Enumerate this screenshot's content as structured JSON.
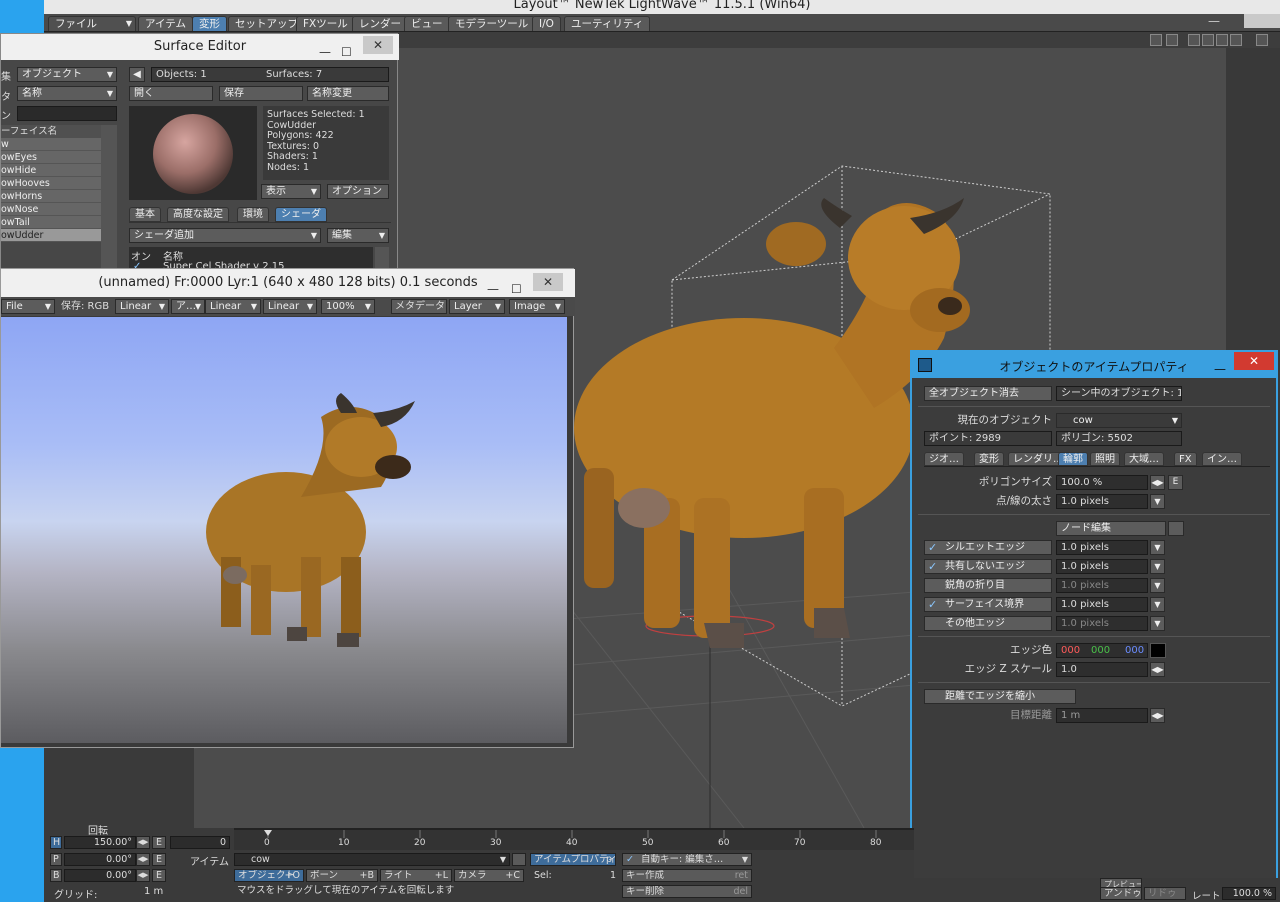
{
  "app": {
    "title": "Layout™ NewTek LightWave™ 11.5.1 (Win64)",
    "menu": {
      "file_label": "ファイル",
      "tabs": [
        "アイテム",
        "変形",
        "セットアップ",
        "FXツール",
        "レンダー",
        "ビュー",
        "モデラーツール",
        "I/O",
        "ユーティリティ"
      ],
      "active_tab": "変形"
    }
  },
  "surface_editor": {
    "title": "Surface Editor",
    "edit_label": "集",
    "edit_value": "オブジェクト",
    "filter_label": "タ",
    "filter_value": "名称",
    "pattern_label": "ン",
    "objects": "Objects: 1",
    "surfaces": "Surfaces: 7",
    "buttons": {
      "open": "開く",
      "save": "保存",
      "rename": "名称変更"
    },
    "list_header": "ーフェイス名",
    "surface_list": [
      "w",
      "owEyes",
      "owHide",
      "owHooves",
      "owHorns",
      "owNose",
      "owTail",
      "owUdder"
    ],
    "info": [
      "Surfaces Selected: 1",
      "CowUdder",
      "Polygons: 422",
      "Textures: 0",
      "Shaders: 1",
      "Nodes: 1"
    ],
    "display_label": "表示",
    "options_label": "オプション",
    "tabs": [
      "基本",
      "高度な設定",
      "環境",
      "シェーダ"
    ],
    "active_tab": "シェーダ",
    "add_shader": "シェーダ追加",
    "edit_btn": "編集",
    "shader_cols": [
      "オン",
      "名称"
    ],
    "shader_row": "Super Cel Shader v 2.15"
  },
  "render_window": {
    "title": "(unnamed) Fr:0000 Lyr:1  (640 x 480 128 bits) 0.1 seconds",
    "tools": [
      "File",
      "保存: RGB",
      "Linear",
      "ア…",
      "Linear",
      "Linear",
      "100%",
      "メタデータ",
      "Layer",
      "Image"
    ]
  },
  "properties": {
    "title": "オブジェクトのアイテムプロパティ",
    "clear_all": "全オブジェクト消去",
    "scene_objects": "シーン中のオブジェクト: 1",
    "current_object_label": "現在のオブジェクト",
    "current_object": "cow",
    "points": "ポイント: 2989",
    "polygons": "ポリゴン: 5502",
    "tabs": [
      "ジオ…",
      "変形",
      "レンダリ…",
      "輪郭",
      "照明",
      "大域…",
      "FX",
      "イン…"
    ],
    "active_tab": "輪郭",
    "polygon_size_label": "ポリゴンサイズ",
    "polygon_size": "100.0 %",
    "point_line_label": "点/線の太さ",
    "point_line": "1.0 pixels",
    "node_edit": "ノード編集",
    "edges": [
      {
        "label": "シルエットエッジ",
        "checked": true,
        "value": "1.0 pixels"
      },
      {
        "label": "共有しないエッジ",
        "checked": true,
        "value": "1.0 pixels"
      },
      {
        "label": "鋭角の折り目",
        "checked": false,
        "value": "1.0 pixels"
      },
      {
        "label": "サーフェイス境界",
        "checked": true,
        "value": "1.0 pixels"
      },
      {
        "label": "その他エッジ",
        "checked": false,
        "value": "1.0 pixels"
      }
    ],
    "edge_color_label": "エッジ色",
    "edge_color": [
      "000",
      "000",
      "000"
    ],
    "edge_z_label": "エッジ Z スケール",
    "edge_z": "1.0",
    "shrink_by_distance": "距離でエッジを縮小",
    "target_distance_label": "目標距離",
    "target_distance": "1 m",
    "e_label": "E"
  },
  "bottom": {
    "rotate_label": "回転",
    "h_label": "H",
    "h_value": "150.00°",
    "p_label": "P",
    "p_value": "0.00°",
    "b_label": "B",
    "b_value": "0.00°",
    "grid_label": "グリッド:",
    "grid_value": "1 m",
    "frame_value": "0",
    "ticks": [
      "0",
      "10",
      "20",
      "30",
      "40",
      "50",
      "60",
      "70",
      "80"
    ],
    "item_label": "アイテム",
    "item_value": "cow",
    "item_props": "アイテムプロパティ",
    "item_props_key": "p",
    "auto_key": "自動キー: 編集さ…",
    "modes": [
      {
        "label": "オブジェクト",
        "key": "+O"
      },
      {
        "label": "ボーン",
        "key": "+B"
      },
      {
        "label": "ライト",
        "key": "+L"
      },
      {
        "label": "カメラ",
        "key": "+C"
      }
    ],
    "sel_label": "Sel:",
    "sel_value": "1",
    "create_key": "キー作成",
    "create_key_hint": "ret",
    "delete_key": "キー削除",
    "delete_key_hint": "del",
    "status": "マウスをドラッグして現在のアイテムを回転します",
    "undo": "アンドゥ",
    "redo": "リドゥ",
    "rate_label": "レート",
    "rate_value": "100.0 %",
    "preview": "プレビュー"
  }
}
